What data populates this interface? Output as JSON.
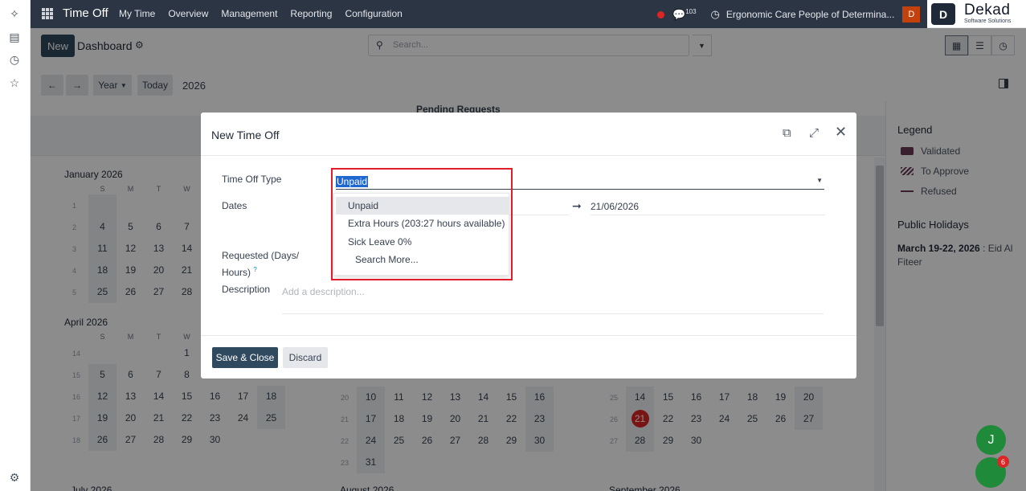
{
  "navbar": {
    "app_name": "Time Off",
    "menu": [
      "My Time",
      "Overview",
      "Management",
      "Reporting",
      "Configuration"
    ],
    "message_count": "103",
    "company": "Ergonomic Care People of Determina...",
    "user_initial": "D"
  },
  "logo": {
    "name": "Dekad",
    "tagline": "Software Solutions"
  },
  "control": {
    "new_label": "New",
    "title": "Dashboard",
    "search_placeholder": "Search...",
    "scale_label": "Year",
    "today_label": "Today",
    "year": "2026"
  },
  "calendar": {
    "pending_label": "Pending Requests",
    "weekday_headers": [
      "S",
      "M",
      "T",
      "W"
    ],
    "months": [
      {
        "name": "January 2026",
        "weeks": [
          {
            "num": "1",
            "days": [
              "",
              "",
              "",
              ""
            ]
          },
          {
            "num": "2",
            "days": [
              "4",
              "5",
              "6",
              "7"
            ]
          },
          {
            "num": "3",
            "days": [
              "11",
              "12",
              "13",
              "14"
            ]
          },
          {
            "num": "4",
            "days": [
              "18",
              "19",
              "20",
              "21"
            ]
          },
          {
            "num": "5",
            "days": [
              "25",
              "26",
              "27",
              "28"
            ]
          }
        ]
      },
      {
        "name": "April 2026",
        "weeks": [
          {
            "num": "14",
            "days": [
              "",
              "",
              "",
              "1"
            ]
          },
          {
            "num": "15",
            "days": [
              "5",
              "6",
              "7",
              "8"
            ]
          },
          {
            "num": "16",
            "days": [
              "12",
              "13",
              "14",
              "15",
              "16",
              "17",
              "18"
            ]
          },
          {
            "num": "17",
            "days": [
              "19",
              "20",
              "21",
              "22",
              "23",
              "24",
              "25"
            ]
          },
          {
            "num": "18",
            "days": [
              "26",
              "27",
              "28",
              "29",
              "30",
              "",
              ""
            ]
          }
        ]
      },
      {
        "name": "May 2026",
        "weeks": [
          {
            "num": "20",
            "days": [
              "10",
              "11",
              "12",
              "13",
              "14",
              "15",
              "16"
            ]
          },
          {
            "num": "21",
            "days": [
              "17",
              "18",
              "19",
              "20",
              "21",
              "22",
              "23"
            ]
          },
          {
            "num": "22",
            "days": [
              "24",
              "25",
              "26",
              "27",
              "28",
              "29",
              "30"
            ]
          },
          {
            "num": "23",
            "days": [
              "31",
              "",
              "",
              "",
              "",
              "",
              ""
            ]
          }
        ]
      },
      {
        "name": "June 2026",
        "today": "21",
        "weeks": [
          {
            "num": "25",
            "days": [
              "14",
              "15",
              "16",
              "17",
              "18",
              "19",
              "20"
            ]
          },
          {
            "num": "26",
            "days": [
              "21",
              "22",
              "23",
              "24",
              "25",
              "26",
              "27"
            ]
          },
          {
            "num": "27",
            "days": [
              "28",
              "29",
              "30",
              "",
              "",
              "",
              ""
            ]
          }
        ]
      }
    ],
    "bottom_months": [
      "July 2026",
      "August 2026",
      "September 2026"
    ]
  },
  "legend": {
    "title": "Legend",
    "items": [
      "Validated",
      "To Approve",
      "Refused"
    ],
    "holidays_title": "Public Holidays",
    "holiday_date": "March 19-22, 2026",
    "holiday_name": " : Eid Al Fiteer"
  },
  "modal": {
    "title": "New Time Off",
    "type_label": "Time Off Type",
    "type_value": "Unpaid",
    "dates_label": "Dates",
    "date_to": "21/06/2026",
    "requested_label": "Requested (Days/ Hours)",
    "requested_sup": "?",
    "description_label": "Description",
    "description_placeholder": "Add a description...",
    "save_label": "Save & Close",
    "discard_label": "Discard"
  },
  "dropdown": {
    "options": [
      "Unpaid",
      "Extra Hours (203:27 hours available)",
      "Sick Leave 0%"
    ],
    "search_more": "Search More..."
  },
  "fab": {
    "initial": "J",
    "badge": "6"
  }
}
